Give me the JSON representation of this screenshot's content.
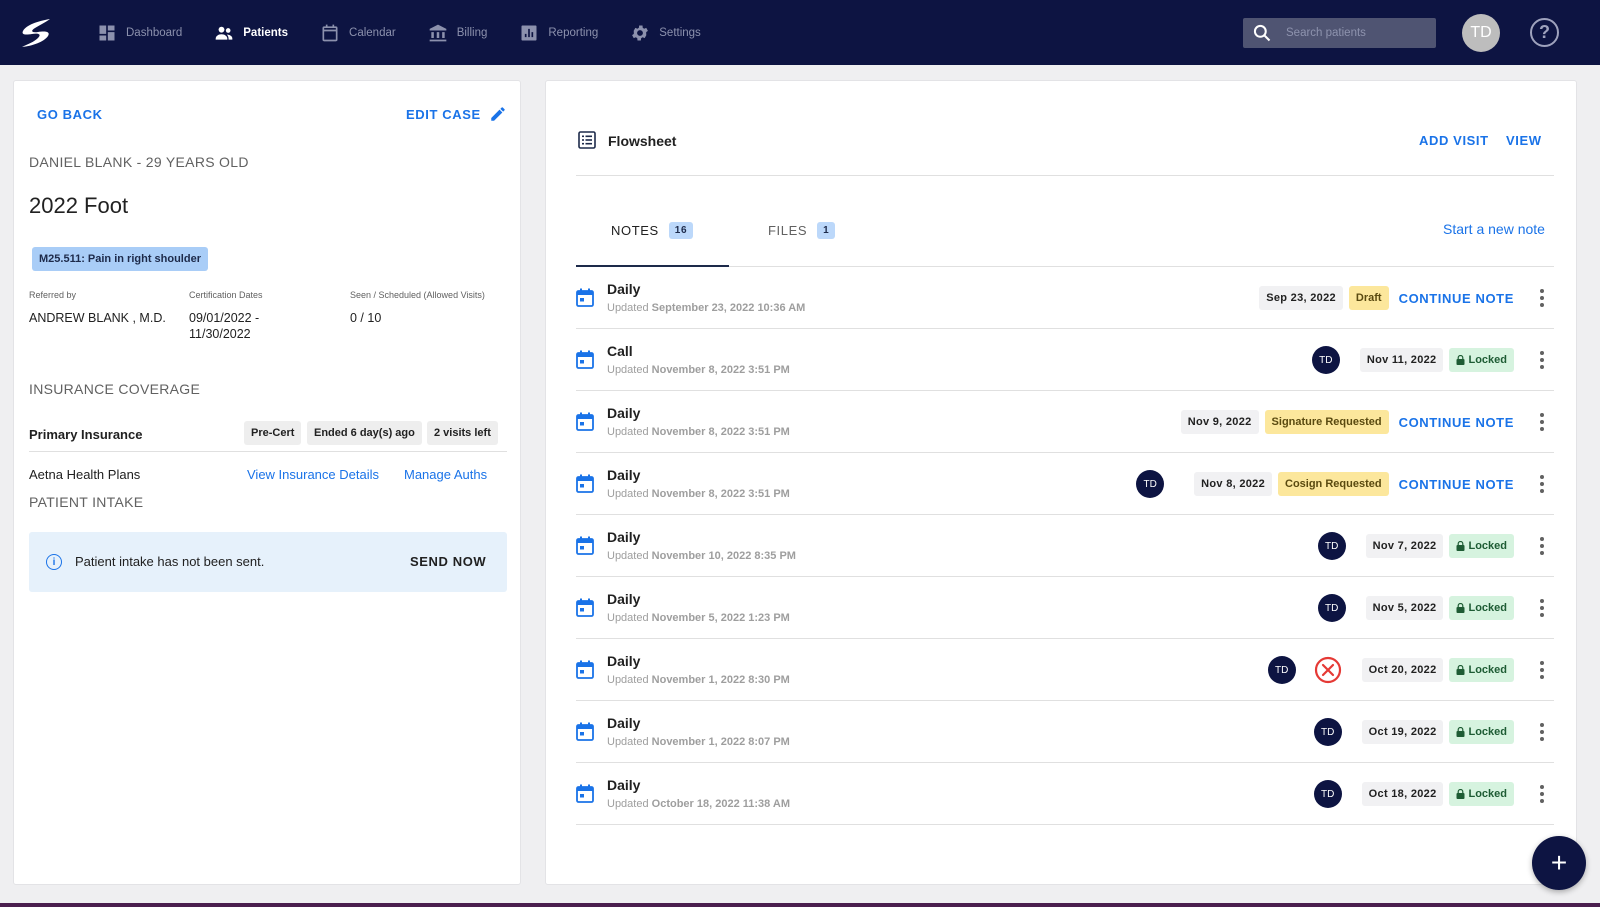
{
  "nav": {
    "items": [
      {
        "label": "Dashboard",
        "icon": "dashboard-icon"
      },
      {
        "label": "Patients",
        "icon": "patients-icon"
      },
      {
        "label": "Calendar",
        "icon": "calendar-icon"
      },
      {
        "label": "Billing",
        "icon": "billing-icon"
      },
      {
        "label": "Reporting",
        "icon": "reporting-icon"
      },
      {
        "label": "Settings",
        "icon": "gear-icon"
      }
    ],
    "active": "Patients",
    "search_placeholder": "Search patients",
    "avatar_initials": "TD",
    "help_glyph": "?"
  },
  "case": {
    "go_back": "GO BACK",
    "edit_case": "EDIT CASE",
    "patient_name": "DANIEL BLANK - 29 YEARS OLD",
    "title": "2022 Foot",
    "diagnosis": "M25.511: Pain in right shoulder",
    "referred_by_label": "Referred by",
    "referred_by": "ANDREW BLANK , M.D.",
    "cert_label": "Certification Dates",
    "cert_start": "09/01/2022 -",
    "cert_end": "11/30/2022",
    "seen_label": "Seen / Scheduled (Allowed Visits)",
    "seen_value": "0 / 10"
  },
  "insurance": {
    "heading": "INSURANCE COVERAGE",
    "primary_label": "Primary Insurance",
    "chips": [
      "Pre-Cert",
      "Ended 6 day(s) ago",
      "2 visits left"
    ],
    "plan": "Aetna Health Plans",
    "view_details": "View Insurance Details",
    "manage_auths": "Manage Auths"
  },
  "intake": {
    "heading": "PATIENT INTAKE",
    "message": "Patient intake has not been sent.",
    "action": "SEND NOW"
  },
  "flowsheet": {
    "title": "Flowsheet",
    "add_visit": "ADD VISIT",
    "view": "VIEW",
    "tabs": [
      {
        "label": "NOTES",
        "count": "16"
      },
      {
        "label": "FILES",
        "count": "1"
      }
    ],
    "start_note": "Start a new note",
    "updated_prefix": "Updated",
    "continue_label": "CONTINUE NOTE",
    "notes": [
      {
        "title": "Daily",
        "updated": "September 23, 2022 10:36 AM",
        "date": "Sep 23, 2022",
        "status": "Draft",
        "status_kind": "warn",
        "avatar": "",
        "rejected": false,
        "continue": true
      },
      {
        "title": "Call",
        "updated": "November 8, 2022 3:51 PM",
        "date": "Nov 11, 2022",
        "status": "Locked",
        "status_kind": "locked",
        "avatar": "TD",
        "rejected": false,
        "continue": false
      },
      {
        "title": "Daily",
        "updated": "November 8, 2022 3:51 PM",
        "date": "Nov 9, 2022",
        "status": "Signature Requested",
        "status_kind": "warn",
        "avatar": "",
        "rejected": false,
        "continue": true
      },
      {
        "title": "Daily",
        "updated": "November 8, 2022 3:51 PM",
        "date": "Nov 8, 2022",
        "status": "Cosign Requested",
        "status_kind": "warn",
        "avatar": "TD",
        "rejected": false,
        "continue": true
      },
      {
        "title": "Daily",
        "updated": "November 10, 2022 8:35 PM",
        "date": "Nov 7, 2022",
        "status": "Locked",
        "status_kind": "locked",
        "avatar": "TD",
        "rejected": false,
        "continue": false
      },
      {
        "title": "Daily",
        "updated": "November 5, 2022 1:23 PM",
        "date": "Nov 5, 2022",
        "status": "Locked",
        "status_kind": "locked",
        "avatar": "TD",
        "rejected": false,
        "continue": false
      },
      {
        "title": "Daily",
        "updated": "November 1, 2022 8:30 PM",
        "date": "Oct 20, 2022",
        "status": "Locked",
        "status_kind": "locked",
        "avatar": "TD",
        "rejected": true,
        "continue": false
      },
      {
        "title": "Daily",
        "updated": "November 1, 2022 8:07 PM",
        "date": "Oct 19, 2022",
        "status": "Locked",
        "status_kind": "locked",
        "avatar": "TD",
        "rejected": false,
        "continue": false
      },
      {
        "title": "Daily",
        "updated": "October 18, 2022 11:38 AM",
        "date": "Oct 18, 2022",
        "status": "Locked",
        "status_kind": "locked",
        "avatar": "TD",
        "rejected": false,
        "continue": false
      }
    ]
  },
  "fab_glyph": "+",
  "colors": {
    "topbar": "#0d1442",
    "accent": "#1a73e8",
    "draft": "#fce79c",
    "locked": "#d6f3df",
    "rejected": "#e53935"
  }
}
